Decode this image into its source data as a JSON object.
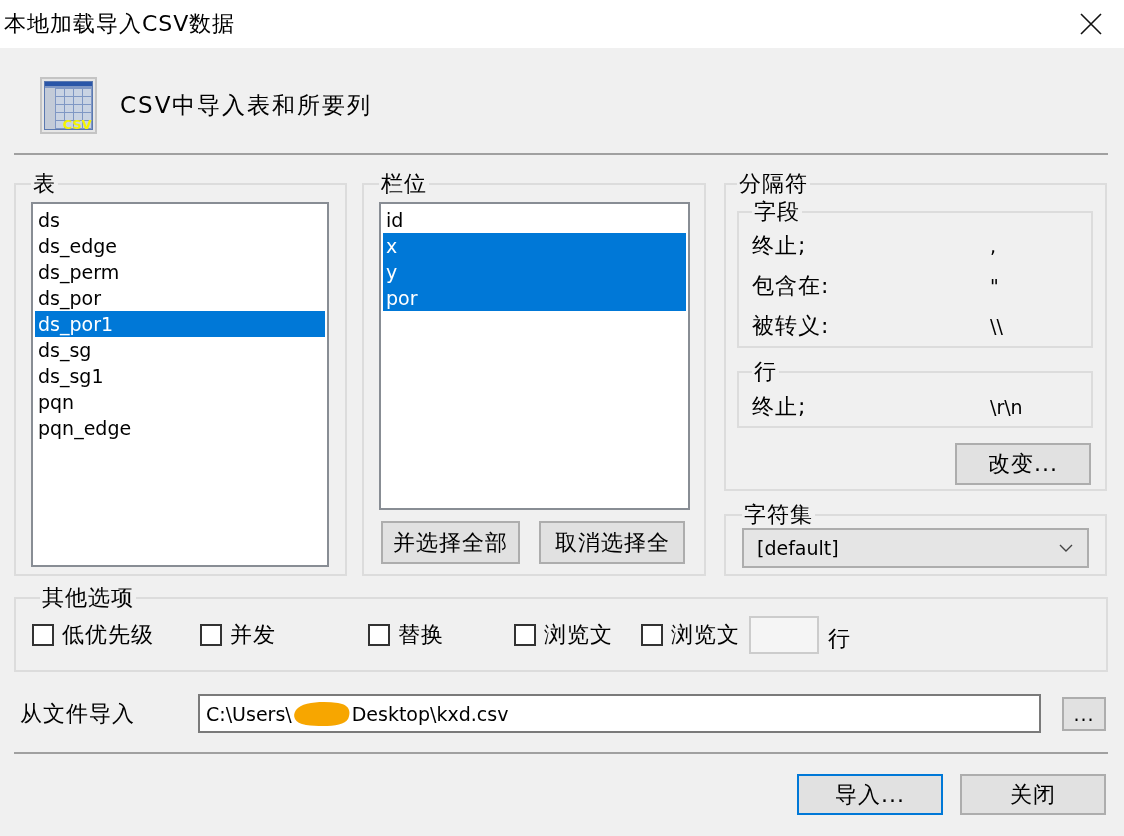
{
  "window": {
    "title": "本地加载导入CSV数据"
  },
  "header": {
    "icon_label": "CSV",
    "text": "CSV中导入表和所要列"
  },
  "tables": {
    "label": "表",
    "items": [
      {
        "label": "ds",
        "selected": false
      },
      {
        "label": "ds_edge",
        "selected": false
      },
      {
        "label": "ds_perm",
        "selected": false
      },
      {
        "label": "ds_por",
        "selected": false
      },
      {
        "label": "ds_por1",
        "selected": true
      },
      {
        "label": "ds_sg",
        "selected": false
      },
      {
        "label": "ds_sg1",
        "selected": false
      },
      {
        "label": "pqn",
        "selected": false
      },
      {
        "label": "pqn_edge",
        "selected": false
      }
    ]
  },
  "columns": {
    "label": "栏位",
    "items": [
      {
        "label": "id",
        "selected": false
      },
      {
        "label": "x",
        "selected": true
      },
      {
        "label": "y",
        "selected": true
      },
      {
        "label": "por",
        "selected": true
      }
    ],
    "buttons": [
      "并选择全部",
      "取消选择全"
    ]
  },
  "delimiters": {
    "label": "分隔符",
    "field": {
      "label": "字段",
      "rows": [
        {
          "label": "终止;",
          "value": ","
        },
        {
          "label": "包含在:",
          "value": "\""
        },
        {
          "label": "被转义:",
          "value": "\\\\"
        }
      ]
    },
    "line": {
      "label": "行",
      "rows": [
        {
          "label": "终止;",
          "value": "\\r\\n"
        }
      ]
    },
    "change_button": "改变..."
  },
  "charset": {
    "label": "字符集",
    "value": "[default]"
  },
  "options": {
    "label": "其他选项",
    "checkboxes": [
      {
        "label": "低优先级",
        "checked": false
      },
      {
        "label": "并发",
        "checked": false
      },
      {
        "label": "替换",
        "checked": false
      },
      {
        "label": "浏览文",
        "checked": false
      },
      {
        "label": "浏览文",
        "checked": false
      }
    ],
    "unit_label": "行"
  },
  "file": {
    "label": "从文件导入",
    "path_start": "C:\\Users\\",
    "path_end": "Desktop\\kxd.csv",
    "redacted": true,
    "browse_button": "..."
  },
  "buttons": [
    {
      "label": "导入...",
      "focused": true
    },
    {
      "label": "关闭",
      "focused": false
    }
  ]
}
